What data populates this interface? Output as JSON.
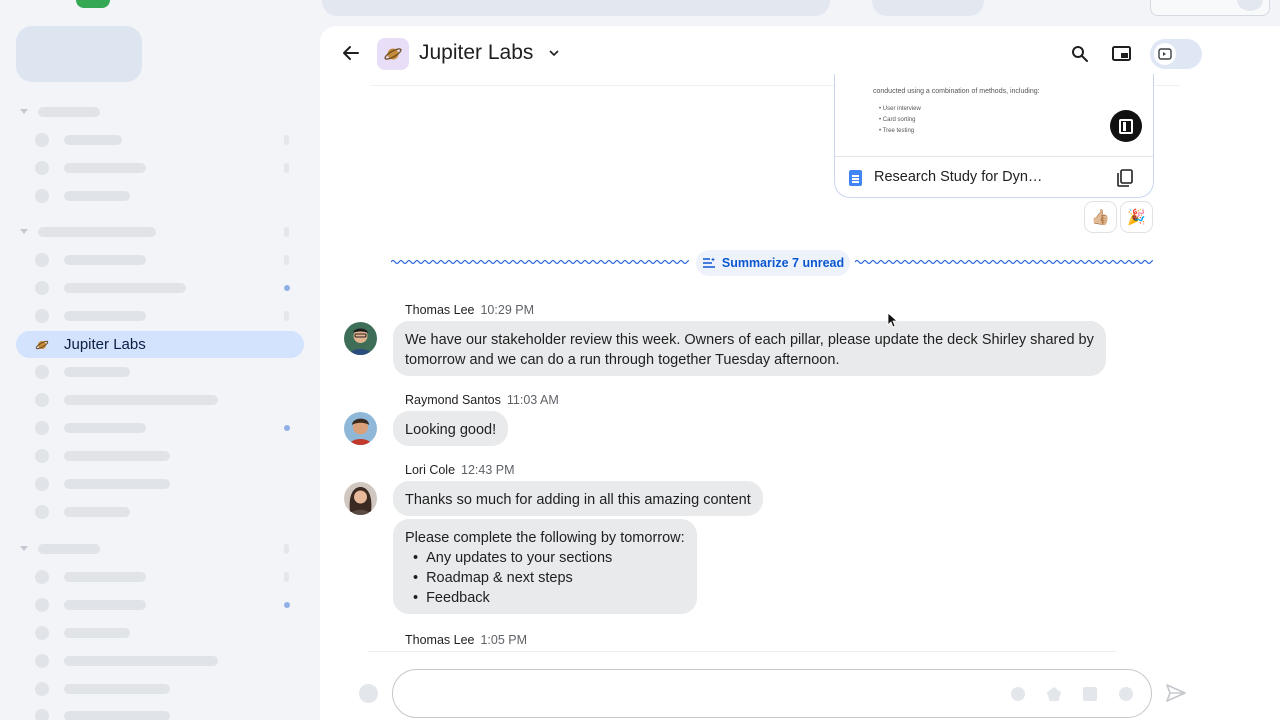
{
  "room": {
    "title": "Jupiter Labs",
    "sidebar_label": "Jupiter Labs"
  },
  "attachment": {
    "preview_line": "conducted using a combination of methods, including:",
    "preview_items": [
      "User interview",
      "Card sorting",
      "Tree testing"
    ],
    "file_name": "Research Study for Dyn…"
  },
  "reactions": [
    "👍🏼",
    "🎉"
  ],
  "unread": {
    "summarize_label": "Summarize 7 unread"
  },
  "messages": [
    {
      "sender": "Thomas Lee",
      "time": "10:29 PM",
      "lines": [
        "We have our stakeholder review this week. Owners of each pillar, please update the deck Shirley shared by",
        "tomorrow and we can do a run through together Tuesday afternoon."
      ]
    },
    {
      "sender": "Raymond Santos",
      "time": "11:03 AM",
      "text": "Looking good!"
    },
    {
      "sender": "Lori Cole",
      "time": "12:43 PM",
      "text": "Thanks so much for adding in all this amazing content",
      "followup_intro": "Please complete the following by tomorrow:",
      "followup_items": [
        "Any updates to your sections",
        "Roadmap & next steps",
        "Feedback"
      ]
    },
    {
      "sender": "Thomas Lee",
      "time": "1:05 PM"
    }
  ],
  "colors": {
    "accent": "#0b57d0",
    "active_space_bg": "#d3e3fd",
    "bubble_bg": "#e9eaec",
    "unread_wave": "#2f6bd8"
  }
}
